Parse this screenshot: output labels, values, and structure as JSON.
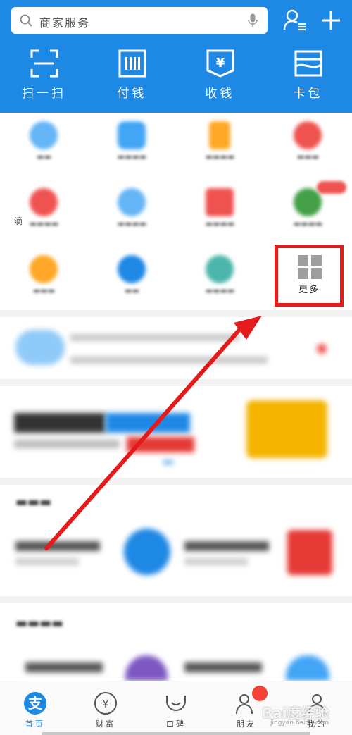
{
  "header": {
    "search_placeholder": "商家服务",
    "quick_actions": [
      {
        "label": "扫一扫",
        "icon": "scan-icon"
      },
      {
        "label": "付钱",
        "icon": "pay-barcode-icon"
      },
      {
        "label": "收钱",
        "icon": "receive-money-icon"
      },
      {
        "label": "卡包",
        "icon": "card-wallet-icon"
      }
    ]
  },
  "grid": {
    "more_label": "更多",
    "edge_char": "滴"
  },
  "tabbar": {
    "tabs": [
      {
        "label": "首页",
        "icon": "alipay-home-icon",
        "active": true
      },
      {
        "label": "财富",
        "icon": "wealth-yuan-icon",
        "active": false
      },
      {
        "label": "口碑",
        "icon": "koubei-smile-icon",
        "active": false
      },
      {
        "label": "朋友",
        "icon": "friends-icon",
        "active": false
      },
      {
        "label": "我的",
        "icon": "profile-icon",
        "active": false
      }
    ]
  },
  "watermark": {
    "text": "Bai度经验",
    "url": "jingyan.baidu.com"
  },
  "colors": {
    "header_blue": "#1e88e5",
    "highlight_red": "#e51b1b"
  }
}
